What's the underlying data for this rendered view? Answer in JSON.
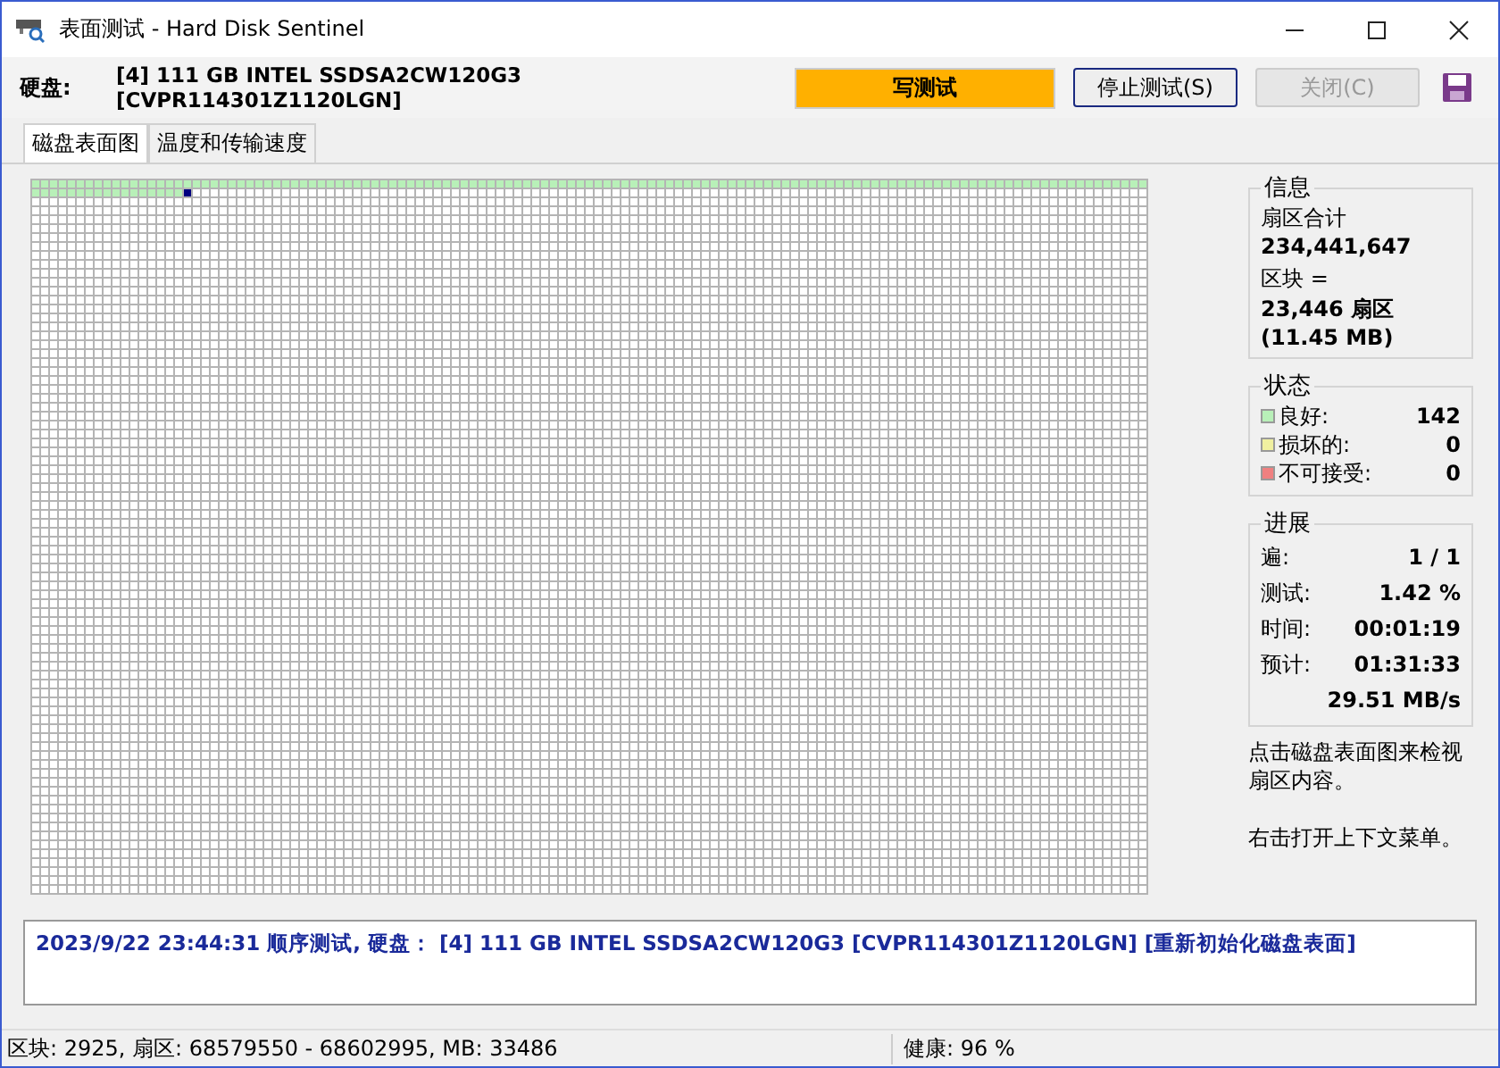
{
  "window": {
    "title": "表面测试 - Hard Disk Sentinel"
  },
  "toolbar": {
    "disk_label": "硬盘:",
    "disk": "[4] 111 GB  INTEL SSDSA2CW120G3 [CVPR114301Z1120LGN]",
    "mode": "写测试",
    "buttons": [
      {
        "label": "停止测试(S)",
        "disabled": false
      },
      {
        "label": "关闭(C)",
        "disabled": true
      }
    ]
  },
  "tabs": [
    {
      "label": "磁盘表面图",
      "selected": true
    },
    {
      "label": "温度和传输速度",
      "selected": false
    }
  ],
  "info": {
    "title": "信息",
    "total_label": "扇区合计",
    "total": "234,441,647",
    "block_label": "区块 =",
    "block": "23,446 扇区",
    "block_size": "(11.45 MB)"
  },
  "status": {
    "title": "状态",
    "items": [
      {
        "label": "良好:",
        "value": "142",
        "color": "#b8f0b8"
      },
      {
        "label": "损坏的:",
        "value": "0",
        "color": "#f0f0a0"
      },
      {
        "label": "不可接受:",
        "value": "0",
        "color": "#f08080"
      }
    ]
  },
  "progress": {
    "title": "进展",
    "rows": [
      {
        "label": "遍:",
        "value": "1 / 1"
      },
      {
        "label": "测试:",
        "value": "1.42 %"
      },
      {
        "label": "时间:",
        "value": "00:01:19"
      },
      {
        "label": "预计:",
        "value": "01:31:33"
      },
      {
        "label": "",
        "value": "29.51 MB/s"
      }
    ]
  },
  "hints": [
    "点击磁盘表面图来检视扇区内容。",
    "右击打开上下文菜单。"
  ],
  "log": "2023/9/22  23:44:31   顺序测试, 硬盘：  [4] 111 GB  INTEL SSDSA2CW120G3 [CVPR114301Z1120LGN] [重新初始化磁盘表面]",
  "status_bar": [
    "区块: 2925, 扇区: 68579550 - 68602995, MB: 33486",
    "健康:   96 %"
  ]
}
